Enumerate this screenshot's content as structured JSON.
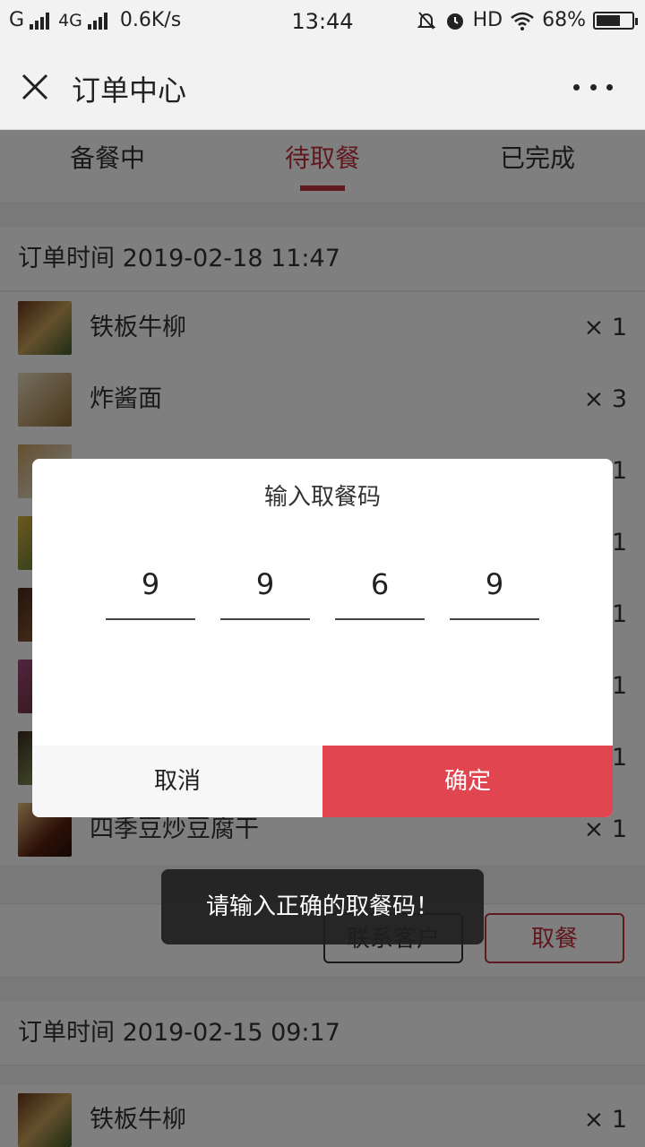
{
  "status": {
    "carrier1": "G",
    "carrier2": "4G",
    "speed": "0.6K/s",
    "time": "13:44",
    "hd": "HD",
    "battery": "68%",
    "battery_level": 0.68
  },
  "nav": {
    "title": "订单中心"
  },
  "tabs": [
    {
      "label": "备餐中"
    },
    {
      "label": "待取餐"
    },
    {
      "label": "已完成"
    }
  ],
  "active_tab": 1,
  "orders": [
    {
      "time": "订单时间 2019-02-18 11:47",
      "items": [
        {
          "name": "铁板牛柳",
          "qty": "× 1"
        },
        {
          "name": "炸酱面",
          "qty": "× 3"
        },
        {
          "name": "",
          "qty": "1"
        },
        {
          "name": "",
          "qty": "1"
        },
        {
          "name": "",
          "qty": "1"
        },
        {
          "name": "",
          "qty": "1"
        },
        {
          "name": "",
          "qty": "1"
        },
        {
          "name": "四季豆炒豆腐干",
          "qty": "× 1"
        }
      ],
      "contact_label": "联系客户",
      "pickup_label": "取餐"
    },
    {
      "time": "订单时间 2019-02-15 09:17",
      "items": [
        {
          "name": "铁板牛柳",
          "qty": "× 1"
        }
      ]
    }
  ],
  "dialog": {
    "title": "输入取餐码",
    "code": [
      "9",
      "9",
      "6",
      "9"
    ],
    "cancel": "取消",
    "confirm": "确定"
  },
  "toast": "请输入正确的取餐码！",
  "colors": {
    "accent": "#c0323c",
    "confirm_bg": "#e04550"
  }
}
